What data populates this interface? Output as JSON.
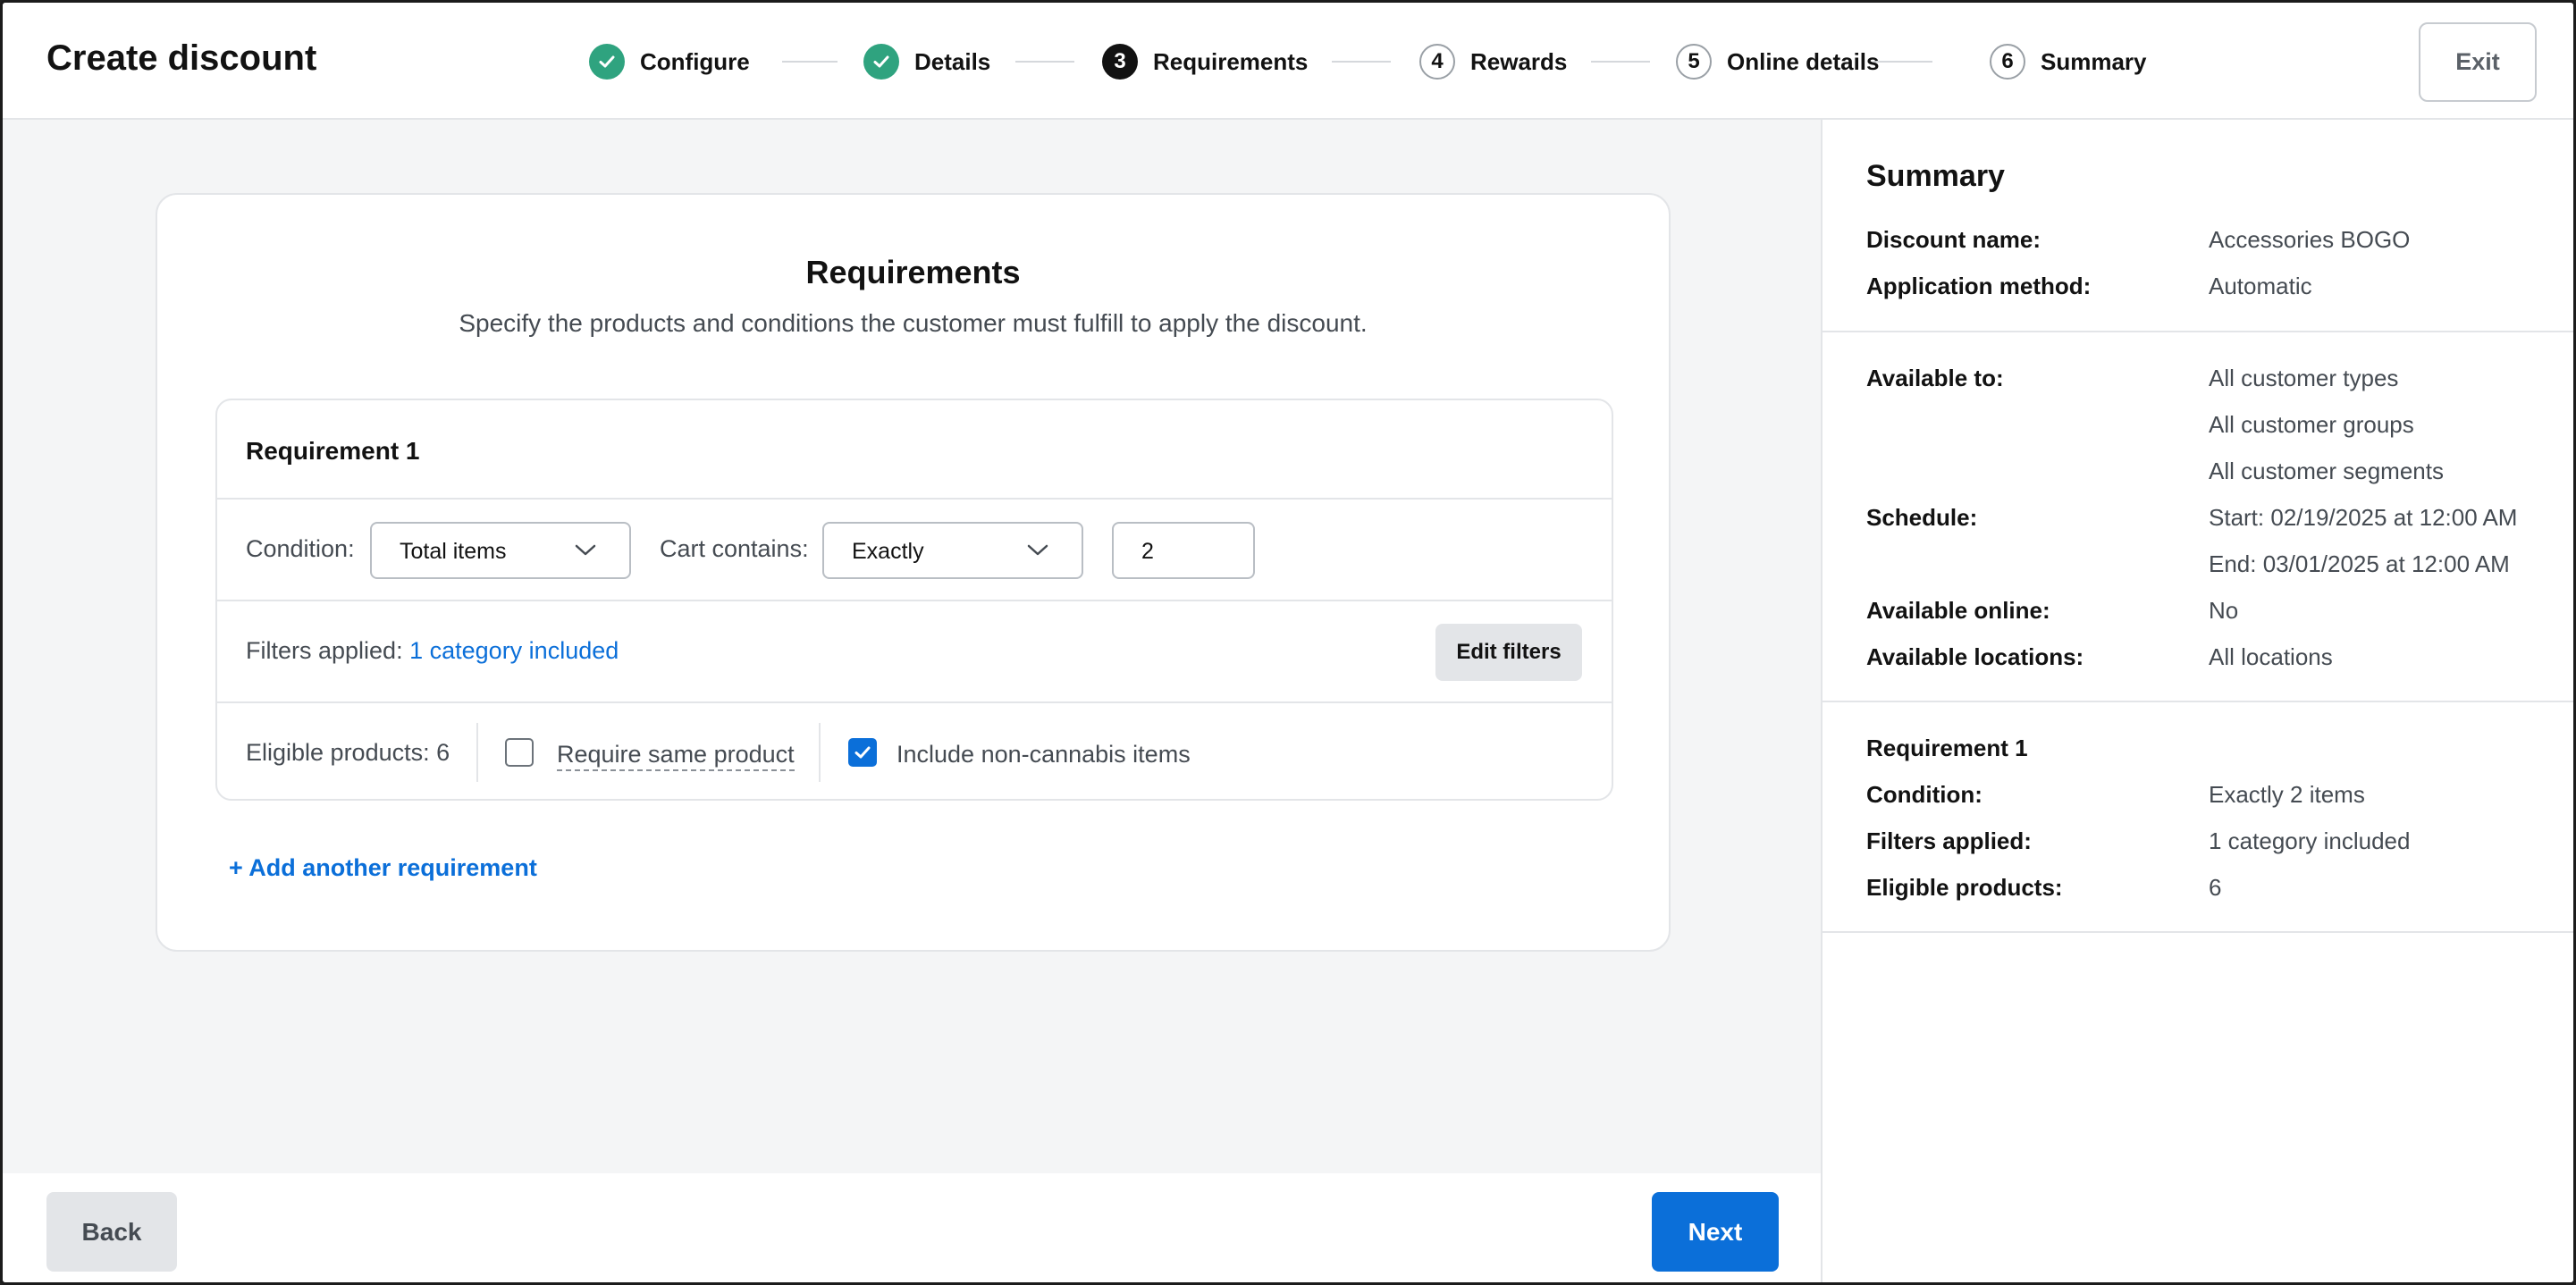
{
  "header": {
    "title": "Create discount",
    "exit_label": "Exit",
    "steps": [
      {
        "number": "1",
        "label": "Configure",
        "status": "completed"
      },
      {
        "number": "2",
        "label": "Details",
        "status": "completed"
      },
      {
        "number": "3",
        "label": "Requirements",
        "status": "current"
      },
      {
        "number": "4",
        "label": "Rewards",
        "status": "upcoming"
      },
      {
        "number": "5",
        "label": "Online details",
        "status": "upcoming"
      },
      {
        "number": "6",
        "label": "Summary",
        "status": "upcoming"
      }
    ]
  },
  "main": {
    "title": "Requirements",
    "subtitle": "Specify the products and conditions the customer must fulfill to apply the discount.",
    "requirement": {
      "title": "Requirement 1",
      "condition_label": "Condition:",
      "condition_value": "Total items",
      "cart_label": "Cart contains:",
      "cart_value": "Exactly",
      "quantity_value": "2",
      "filters_label": "Filters applied:",
      "filters_link": "1 category included",
      "edit_filters_label": "Edit filters",
      "eligible_label": "Eligible products: 6",
      "same_product_label": "Require same product",
      "same_product_checked": false,
      "non_cannabis_label": "Include non-cannabis items",
      "non_cannabis_checked": true
    },
    "add_requirement_label": "+ Add another requirement"
  },
  "footer": {
    "back_label": "Back",
    "next_label": "Next"
  },
  "summary": {
    "title": "Summary",
    "discount_name_key": "Discount name:",
    "discount_name_val": "Accessories BOGO",
    "application_key": "Application method:",
    "application_val": "Automatic",
    "available_to_key": "Available to:",
    "available_to_vals": [
      "All customer types",
      "All customer groups",
      "All customer segments"
    ],
    "schedule_key": "Schedule:",
    "schedule_start": "Start: 02/19/2025 at 12:00 AM",
    "schedule_end": "End: 03/01/2025 at 12:00 AM",
    "online_key": "Available online:",
    "online_val": "No",
    "locations_key": "Available locations:",
    "locations_val": "All locations",
    "req_title": "Requirement 1",
    "req_condition_key": "Condition:",
    "req_condition_val": "Exactly 2 items",
    "req_filters_key": "Filters applied:",
    "req_filters_val": "1 category included",
    "req_eligible_key": "Eligible products:",
    "req_eligible_val": "6"
  },
  "colors": {
    "accent": "#0b6fd9",
    "completed": "#2fa37f",
    "current": "#121212"
  }
}
